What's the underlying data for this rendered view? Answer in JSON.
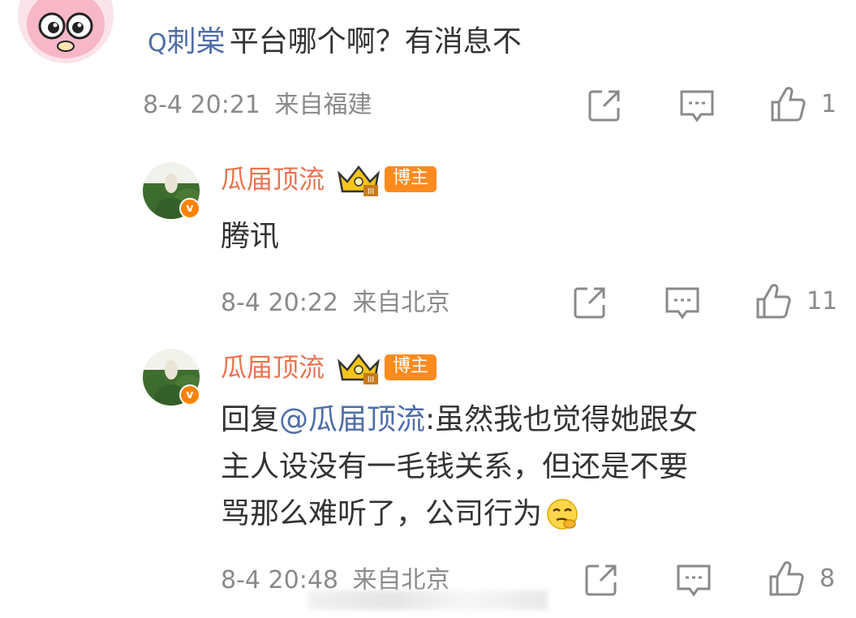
{
  "comment": {
    "search_glyph": "Q",
    "username": "刺棠",
    "text": "平台哪个啊？有消息不",
    "date": "8-4 20:21",
    "location": "来自福建",
    "like_count": "1"
  },
  "replies": [
    {
      "username": "瓜届顶流",
      "badge": "博主",
      "verified_mark": "v",
      "rank_mark": "III",
      "text_lines": [
        "腾讯"
      ],
      "date": "8-4 20:22",
      "location": "来自北京",
      "like_count": "11"
    },
    {
      "username": "瓜届顶流",
      "badge": "博主",
      "verified_mark": "v",
      "rank_mark": "III",
      "reply_prefix": "回复",
      "mention": "@瓜届顶流",
      "line1_rest": ":虽然我也觉得她跟女",
      "line2": "主人设没有一毛钱关系，但还是不要",
      "line3": "骂那么难听了，公司行为",
      "date": "8-4 20:48",
      "location": "来自北京",
      "like_count": "8"
    }
  ],
  "icons": {
    "share": "share-icon",
    "comment": "comment-icon",
    "like": "thumbs-up-icon",
    "crown": "crown-icon",
    "emoji": "thinking-emoji-icon"
  },
  "colors": {
    "link_blue": "#4e6ea8",
    "orange_name": "#eb7350",
    "badge_orange": "#ff8a1e",
    "meta_gray": "#8a8a8a"
  }
}
